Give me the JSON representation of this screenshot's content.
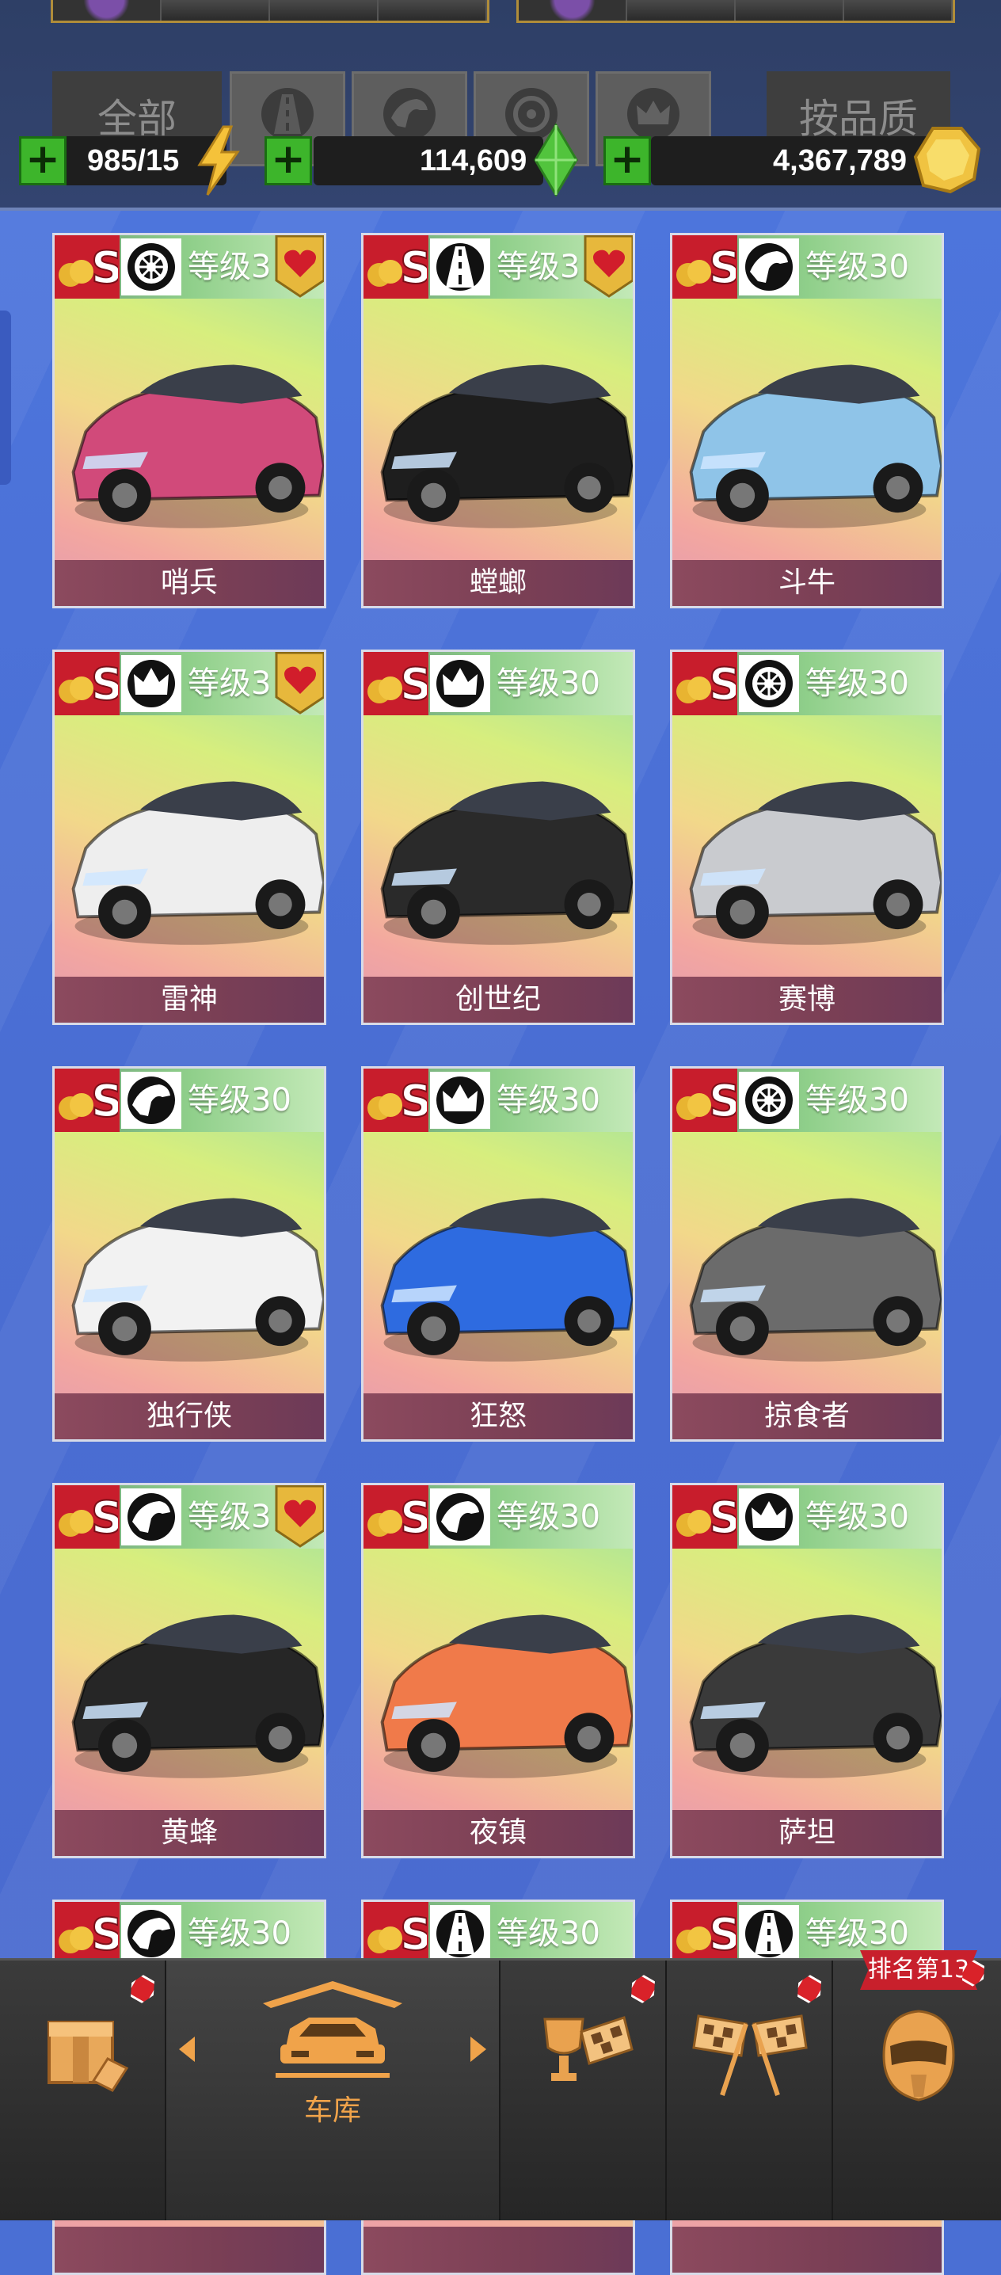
{
  "header": {
    "filter_all": "全部",
    "filter_by_quality": "按品质",
    "filter_icons": [
      "road-icon",
      "horse-icon",
      "wheel-icon",
      "crown-icon"
    ]
  },
  "resources": {
    "energy": "985/15",
    "gems": "114,609",
    "coins": "4,367,789"
  },
  "cards": [
    {
      "name": "哨兵",
      "level": "等级3",
      "class_icon": "wheel-icon",
      "favorite": true,
      "color": "#d14a7a"
    },
    {
      "name": "螳螂",
      "level": "等级3",
      "class_icon": "road-icon",
      "favorite": true,
      "color": "#1e1e1e"
    },
    {
      "name": "斗牛",
      "level": "等级30",
      "class_icon": "horse-icon",
      "favorite": false,
      "color": "#8fc4e8"
    },
    {
      "name": "雷神",
      "level": "等级3",
      "class_icon": "crown-icon",
      "favorite": true,
      "color": "#eeeeee"
    },
    {
      "name": "创世纪",
      "level": "等级30",
      "class_icon": "crown-icon",
      "favorite": false,
      "color": "#2a2a2a"
    },
    {
      "name": "赛博",
      "level": "等级30",
      "class_icon": "wheel-icon",
      "favorite": false,
      "color": "#c9cbcf"
    },
    {
      "name": "独行侠",
      "level": "等级30",
      "class_icon": "horse-icon",
      "favorite": false,
      "color": "#f2f2f2"
    },
    {
      "name": "狂怒",
      "level": "等级30",
      "class_icon": "crown-icon",
      "favorite": false,
      "color": "#2e6be0"
    },
    {
      "name": "掠食者",
      "level": "等级30",
      "class_icon": "wheel-icon",
      "favorite": false,
      "color": "#6b6b6b"
    },
    {
      "name": "黄蜂",
      "level": "等级3",
      "class_icon": "horse-icon",
      "favorite": true,
      "color": "#262626"
    },
    {
      "name": "夜镇",
      "level": "等级30",
      "class_icon": "horse-icon",
      "favorite": false,
      "color": "#f07a4a"
    },
    {
      "name": "萨坦",
      "level": "等级30",
      "class_icon": "crown-icon",
      "favorite": false,
      "color": "#3a3a3a"
    },
    {
      "name": "",
      "level": "等级30",
      "class_icon": "horse-icon",
      "favorite": false,
      "color": "#888888"
    },
    {
      "name": "",
      "level": "等级30",
      "class_icon": "road-icon",
      "favorite": false,
      "color": "#888888"
    },
    {
      "name": "",
      "level": "等级30",
      "class_icon": "road-icon",
      "favorite": false,
      "color": "#888888"
    }
  ],
  "bottom_nav": {
    "garage_label": "车库",
    "rank_label": "排名第13"
  }
}
